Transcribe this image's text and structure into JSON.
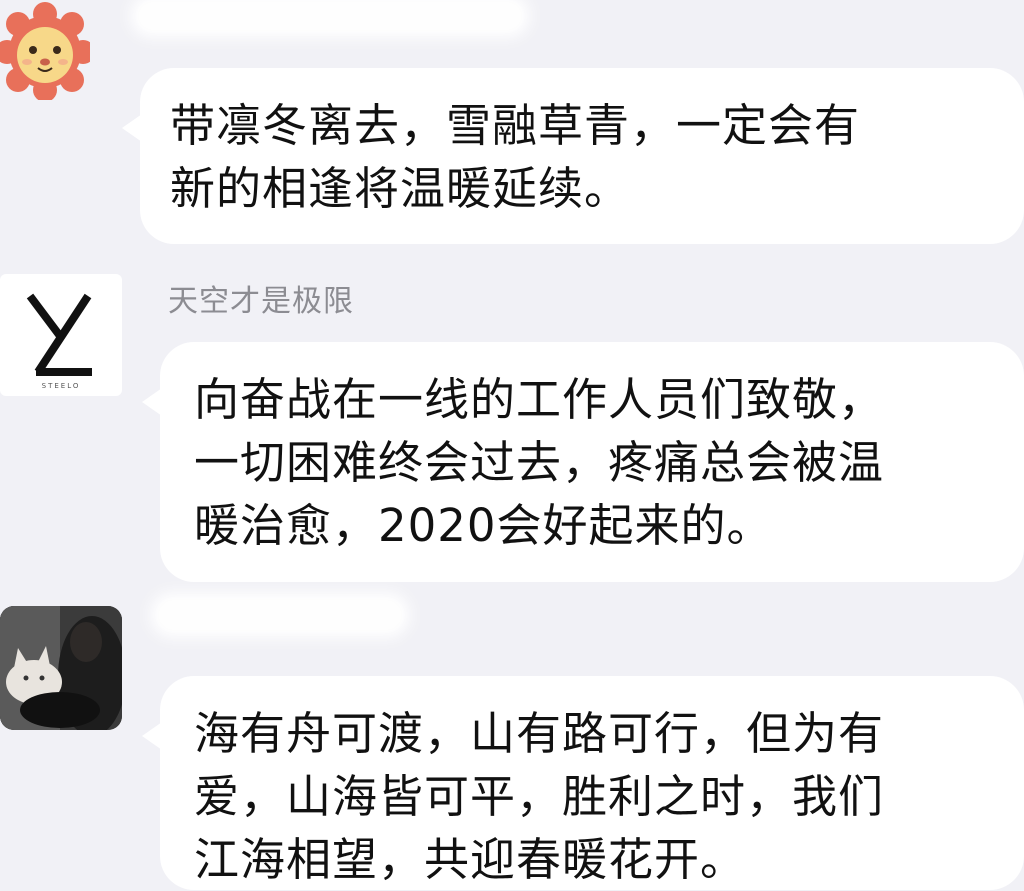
{
  "chat": {
    "messages": [
      {
        "lines": [
          "带凛冬离去，雪融草青，一定会有",
          "新的相逢将温暖延续。"
        ]
      },
      {
        "sender": "天空才是极限",
        "avatar_caption": "STEELO",
        "lines": [
          "向奋战在一线的工作人员们致敬，",
          "一切困难终会过去，疼痛总会被温",
          "暖治愈，2020会好起来的。"
        ]
      },
      {
        "lines": [
          "海有舟可渡，山有路可行，但为有",
          "爱，山海皆可平，胜利之时，我们",
          "江海相望，共迎春暖花开。"
        ]
      }
    ]
  },
  "icons": {
    "avatar_1": "lion-face-icon",
    "avatar_2": "yl-logo-icon",
    "avatar_3": "cat-photo-avatar"
  },
  "colors": {
    "background": "#f1f1f6",
    "bubble": "#ffffff",
    "text": "#111111",
    "sender_name": "#8c8c92",
    "lion_mane": "#e8705a",
    "lion_face": "#f7d889"
  }
}
